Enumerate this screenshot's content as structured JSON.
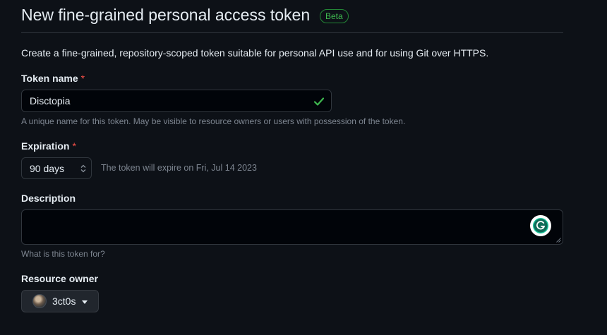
{
  "header": {
    "title": "New fine-grained personal access token",
    "badge": "Beta"
  },
  "intro": "Create a fine-grained, repository-scoped token suitable for personal API use and for using Git over HTTPS.",
  "token_name": {
    "label": "Token name",
    "required_mark": "*",
    "value": "Disctopia",
    "hint": "A unique name for this token. May be visible to resource owners or users with possession of the token.",
    "status_icon": "check-icon"
  },
  "expiration": {
    "label": "Expiration",
    "required_mark": "*",
    "selected": "90 days",
    "note": "The token will expire on Fri, Jul 14 2023"
  },
  "description": {
    "label": "Description",
    "value": "",
    "hint": "What is this token for?",
    "assist_icon": "grammarly-icon"
  },
  "resource_owner": {
    "label": "Resource owner",
    "selected": "3ct0s"
  },
  "colors": {
    "background": "#0d1117",
    "accent_green": "#3fb950",
    "required_red": "#f85149",
    "muted_text": "#7d8590",
    "border": "#30363d"
  }
}
